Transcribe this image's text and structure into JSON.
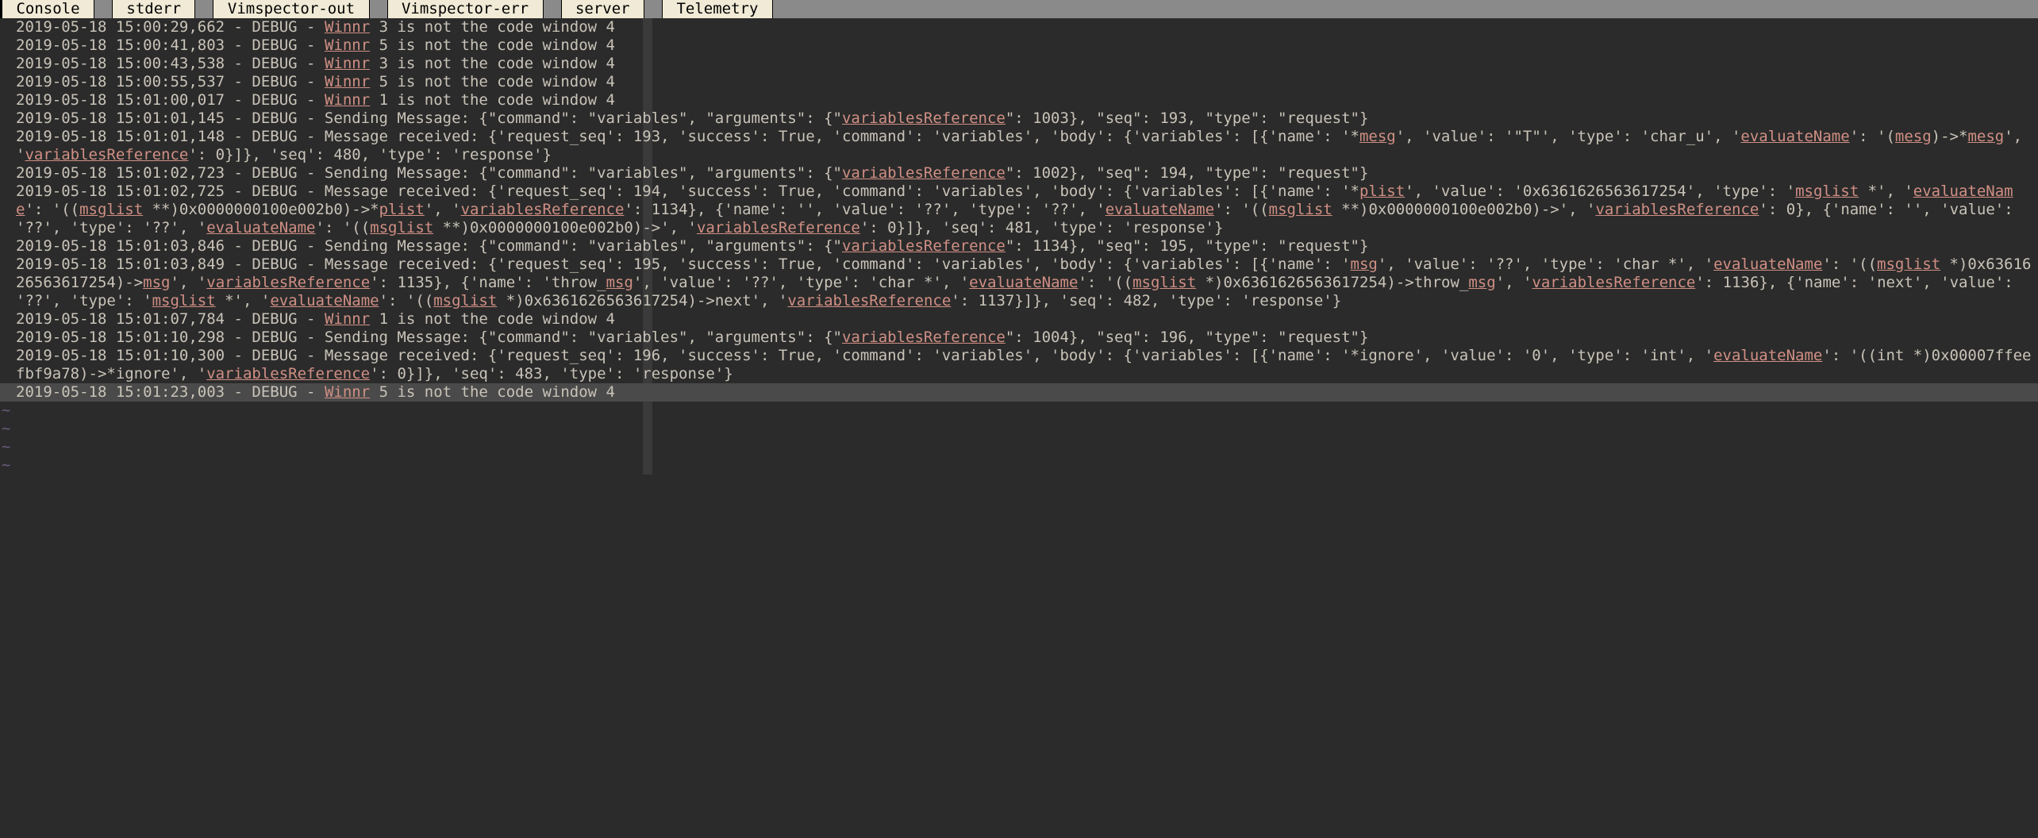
{
  "tabs": [
    {
      "label": " Console "
    },
    {
      "label": " stderr "
    },
    {
      "label": " Vimspector-out "
    },
    {
      "label": " Vimspector-err "
    },
    {
      "label": " server "
    },
    {
      "label": " Telemetry "
    }
  ],
  "log": [
    {
      "segs": [
        {
          "t": "2019-05-18 15:00:29,662 - DEBUG - "
        },
        {
          "t": "Winnr",
          "h": 1
        },
        {
          "t": " 3 is not the code window 4"
        }
      ]
    },
    {
      "segs": [
        {
          "t": "2019-05-18 15:00:41,803 - DEBUG - "
        },
        {
          "t": "Winnr",
          "h": 1
        },
        {
          "t": " 5 is not the code window 4"
        }
      ]
    },
    {
      "segs": [
        {
          "t": "2019-05-18 15:00:43,538 - DEBUG - "
        },
        {
          "t": "Winnr",
          "h": 1
        },
        {
          "t": " 3 is not the code window 4"
        }
      ]
    },
    {
      "segs": [
        {
          "t": "2019-05-18 15:00:55,537 - DEBUG - "
        },
        {
          "t": "Winnr",
          "h": 1
        },
        {
          "t": " 5 is not the code window 4"
        }
      ]
    },
    {
      "segs": [
        {
          "t": "2019-05-18 15:01:00,017 - DEBUG - "
        },
        {
          "t": "Winnr",
          "h": 1
        },
        {
          "t": " 1 is not the code window 4"
        }
      ]
    },
    {
      "segs": [
        {
          "t": "2019-05-18 15:01:01,145 - DEBUG - Sending Message: {\"command\": \"variables\", \"arguments\": {\""
        },
        {
          "t": "variablesReference",
          "h": 1
        },
        {
          "t": "\": 1003}, \"seq\": 193, \"type\": \"request\"}"
        }
      ]
    },
    {
      "segs": [
        {
          "t": "2019-05-18 15:01:01,148 - DEBUG - Message received: {'request_seq': 193, 'success': True, 'command': 'variables', 'body': {'variables': [{'name': '*"
        },
        {
          "t": "mesg",
          "h": 1
        },
        {
          "t": "', 'value': '\"T\"', 'type': 'char_u', '"
        },
        {
          "t": "evaluateName",
          "h": 1
        },
        {
          "t": "': '("
        },
        {
          "t": "mesg",
          "h": 1
        },
        {
          "t": ")->*"
        },
        {
          "t": "mesg",
          "h": 1
        },
        {
          "t": "', '"
        },
        {
          "t": "variablesReference",
          "h": 1
        },
        {
          "t": "': 0}]}, 'seq': 480, 'type': 'response'}"
        }
      ]
    },
    {
      "segs": [
        {
          "t": "2019-05-18 15:01:02,723 - DEBUG - Sending Message: {\"command\": \"variables\", \"arguments\": {\""
        },
        {
          "t": "variablesReference",
          "h": 1
        },
        {
          "t": "\": 1002}, \"seq\": 194, \"type\": \"request\"}"
        }
      ]
    },
    {
      "segs": [
        {
          "t": "2019-05-18 15:01:02,725 - DEBUG - Message received: {'request_seq': 194, 'success': True, 'command': 'variables', 'body': {'variables': [{'name': '*"
        },
        {
          "t": "plist",
          "h": 1
        },
        {
          "t": "', 'value': '0x6361626563617254', 'type': '"
        },
        {
          "t": "msglist",
          "h": 1
        },
        {
          "t": " *', '"
        },
        {
          "t": "evaluateName",
          "h": 1
        },
        {
          "t": "': '(("
        },
        {
          "t": "msglist",
          "h": 1
        },
        {
          "t": " **)0x0000000100e002b0)->*"
        },
        {
          "t": "plist",
          "h": 1
        },
        {
          "t": "', '"
        },
        {
          "t": "variablesReference",
          "h": 1
        },
        {
          "t": "': 1134}, {'name': '', 'value': '??', 'type': '??', '"
        },
        {
          "t": "evaluateName",
          "h": 1
        },
        {
          "t": "': '(("
        },
        {
          "t": "msglist",
          "h": 1
        },
        {
          "t": " **)0x0000000100e002b0)->', '"
        },
        {
          "t": "variablesReference",
          "h": 1
        },
        {
          "t": "': 0}, {'name': '', 'value': '??', 'type': '??', '"
        },
        {
          "t": "evaluateName",
          "h": 1
        },
        {
          "t": "': '(("
        },
        {
          "t": "msglist",
          "h": 1
        },
        {
          "t": " **)0x0000000100e002b0)->', '"
        },
        {
          "t": "variablesReference",
          "h": 1
        },
        {
          "t": "': 0}]}, 'seq': 481, 'type': 'response'}"
        }
      ]
    },
    {
      "segs": [
        {
          "t": "2019-05-18 15:01:03,846 - DEBUG - Sending Message: {\"command\": \"variables\", \"arguments\": {\""
        },
        {
          "t": "variablesReference",
          "h": 1
        },
        {
          "t": "\": 1134}, \"seq\": 195, \"type\": \"request\"}"
        }
      ]
    },
    {
      "segs": [
        {
          "t": "2019-05-18 15:01:03,849 - DEBUG - Message received: {'request_seq': 195, 'success': True, 'command': 'variables', 'body': {'variables': [{'name': '"
        },
        {
          "t": "msg",
          "h": 1
        },
        {
          "t": "', 'value': '??', 'type': 'char *', '"
        },
        {
          "t": "evaluateName",
          "h": 1
        },
        {
          "t": "': '(("
        },
        {
          "t": "msglist",
          "h": 1
        },
        {
          "t": " *)0x6361626563617254)->"
        },
        {
          "t": "msg",
          "h": 1
        },
        {
          "t": "', '"
        },
        {
          "t": "variablesReference",
          "h": 1
        },
        {
          "t": "': 1135}, {'name': 'throw_"
        },
        {
          "t": "msg",
          "h": 1
        },
        {
          "t": "', 'value': '??', 'type': 'char *', '"
        },
        {
          "t": "evaluateName",
          "h": 1
        },
        {
          "t": "': '(("
        },
        {
          "t": "msglist",
          "h": 1
        },
        {
          "t": " *)0x6361626563617254)->throw_"
        },
        {
          "t": "msg",
          "h": 1
        },
        {
          "t": "', '"
        },
        {
          "t": "variablesReference",
          "h": 1
        },
        {
          "t": "': 1136}, {'name': 'next', 'value': '??', 'type': '"
        },
        {
          "t": "msglist",
          "h": 1
        },
        {
          "t": " *', '"
        },
        {
          "t": "evaluateName",
          "h": 1
        },
        {
          "t": "': '(("
        },
        {
          "t": "msglist",
          "h": 1
        },
        {
          "t": " *)0x6361626563617254)->next', '"
        },
        {
          "t": "variablesReference",
          "h": 1
        },
        {
          "t": "': 1137}]}, 'seq': 482, 'type': 'response'}"
        }
      ]
    },
    {
      "segs": [
        {
          "t": "2019-05-18 15:01:07,784 - DEBUG - "
        },
        {
          "t": "Winnr",
          "h": 1
        },
        {
          "t": " 1 is not the code window 4"
        }
      ]
    },
    {
      "segs": [
        {
          "t": "2019-05-18 15:01:10,298 - DEBUG - Sending Message: {\"command\": \"variables\", \"arguments\": {\""
        },
        {
          "t": "variablesReference",
          "h": 1
        },
        {
          "t": "\": 1004}, \"seq\": 196, \"type\": \"request\"}"
        }
      ]
    },
    {
      "segs": [
        {
          "t": "2019-05-18 15:01:10,300 - DEBUG - Message received: {'request_seq': 196, 'success': True, 'command': 'variables', 'body': {'variables': [{'name': '*ignore', 'value': '0', 'type': 'int', '"
        },
        {
          "t": "evaluateName",
          "h": 1
        },
        {
          "t": "': '((int *)0x00007ffeefbf9a78)->*ignore', '"
        },
        {
          "t": "variablesReference",
          "h": 1
        },
        {
          "t": "': 0}]}, 'seq': 483, 'type': 'response'}"
        }
      ]
    },
    {
      "segs": [
        {
          "t": "2019-05-18 15:01:23,003 - DEBUG - "
        },
        {
          "t": "Winnr",
          "h": 1
        },
        {
          "t": " 5 is not the code window 4"
        }
      ],
      "cursor": true
    }
  ],
  "tilde": "~",
  "empty_lines": 4
}
